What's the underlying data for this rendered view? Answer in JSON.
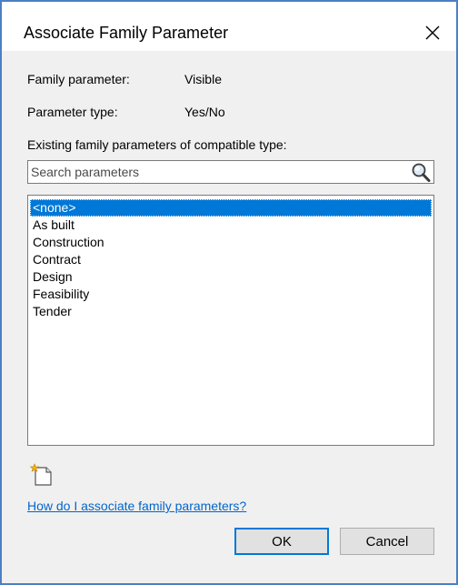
{
  "dialog": {
    "title": "Associate Family Parameter"
  },
  "info": {
    "family_parameter_label": "Family parameter:",
    "family_parameter_value": "Visible",
    "parameter_type_label": "Parameter type:",
    "parameter_type_value": "Yes/No",
    "existing_label": "Existing family parameters of compatible type:"
  },
  "search": {
    "placeholder": "Search parameters",
    "value": ""
  },
  "parameters": {
    "items": [
      {
        "label": "<none>",
        "selected": true
      },
      {
        "label": "As built",
        "selected": false
      },
      {
        "label": "Construction",
        "selected": false
      },
      {
        "label": "Contract",
        "selected": false
      },
      {
        "label": "Design",
        "selected": false
      },
      {
        "label": "Feasibility",
        "selected": false
      },
      {
        "label": "Tender",
        "selected": false
      }
    ]
  },
  "help": {
    "link_text": "How do I associate family parameters?"
  },
  "buttons": {
    "ok_label": "OK",
    "cancel_label": "Cancel"
  },
  "icons": {
    "close": "close-icon",
    "search": "search-icon",
    "new_parameter": "new-parameter-icon"
  },
  "colors": {
    "selection": "#0078d7",
    "link": "#0066cc",
    "window_border": "#4a80c4",
    "dialog_background": "#f0f0f0"
  }
}
